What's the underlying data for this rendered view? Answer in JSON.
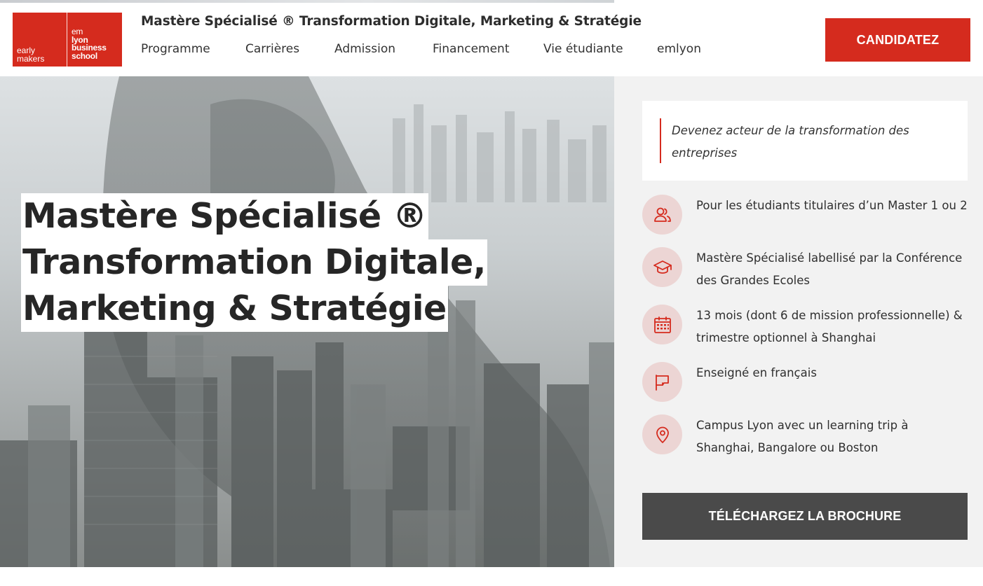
{
  "logo": {
    "left_text_1": "early",
    "left_text_2": "makers",
    "right_text_1": "em",
    "right_text_2": "lyon",
    "right_text_3": "business",
    "right_text_4": "school",
    "brand_color": "#d52b1e"
  },
  "header": {
    "program_title": "Mastère Spécialisé ® Transformation Digitale, Marketing & Stratégie",
    "nav": [
      "Programme",
      "Carrières",
      "Admission",
      "Financement",
      "Vie étudiante",
      "emlyon"
    ],
    "cta_label": "CANDIDATEZ"
  },
  "hero": {
    "title_lines": [
      "Mastère Spécialisé ®",
      "Transformation Digitale,",
      "Marketing & Stratégie"
    ],
    "image_description_icon": "person-city-double-exposure"
  },
  "sidebar": {
    "quote": "Devenez acteur de la transformation des entreprises",
    "features": [
      {
        "icon": "users-icon",
        "text": "Pour les étudiants titulaires d’un Master 1 ou 2"
      },
      {
        "icon": "graduation-cap-icon",
        "text": "Mastère Spécialisé labellisé par la Conférence des Grandes Ecoles"
      },
      {
        "icon": "calendar-icon",
        "text": "13 mois (dont 6 de mission professionnelle) & trimestre optionnel à Shanghai"
      },
      {
        "icon": "flag-icon",
        "text": "Enseigné en français"
      },
      {
        "icon": "location-pin-icon",
        "text": "Campus Lyon avec un learning trip à Shanghai, Bangalore ou Boston"
      }
    ],
    "brochure_label": "TÉLÉCHARGEZ LA BROCHURE",
    "accent_color": "#d52b1e",
    "icon_bg_color": "#ecd5d4",
    "button_dark_color": "#4a4a4a"
  }
}
